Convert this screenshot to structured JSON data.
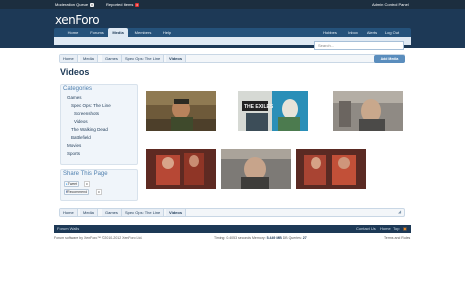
{
  "moderator_bar": {
    "moderation_queue_label": "Moderation Queue",
    "moderation_queue_count": "0",
    "reported_items_label": "Reported Items",
    "reported_items_count": "0",
    "control_panel_label": "Admin Control Panel"
  },
  "logo_text": "xenForo",
  "nav_tabs": [
    "Home",
    "Forums",
    "Media",
    "Members",
    "Help"
  ],
  "active_tab": "Media",
  "account_links": {
    "user": "Hobbes",
    "inbox": "Inbox",
    "alerts": "Alerts",
    "logout": "Log Out"
  },
  "search": {
    "placeholder": "Search..."
  },
  "breadcrumbs": [
    "Home",
    "Media",
    "Games",
    "Spec Ops: The Line",
    "Videos"
  ],
  "add_media_label": "Add Media",
  "page_title": "Videos",
  "categories": {
    "heading": "Categories",
    "items": [
      "Games",
      "Spec Ops: The Line",
      "Screenshots",
      "Videos",
      "The Walking Dead",
      "Battlefield",
      "Movies",
      "Sports"
    ]
  },
  "share": {
    "heading": "Share This Page",
    "tweet_label": "Tweet",
    "tweet_count": "0",
    "recommend_label": "Recommend",
    "recommend_count": "0"
  },
  "thumbnails": [
    {
      "caption": "",
      "scene": "soldier-desert"
    },
    {
      "caption": "THE EXILES",
      "scene": "exiles"
    },
    {
      "caption": "",
      "scene": "soldier-gray"
    },
    {
      "caption": "",
      "scene": "red-armor"
    },
    {
      "caption": "",
      "scene": "soldier-face"
    },
    {
      "caption": "",
      "scene": "red-armor-2"
    }
  ],
  "footer": {
    "left_link": "Forum Walls",
    "contact": "Contact Us",
    "home": "Home",
    "top": "Top"
  },
  "legal": {
    "copyright": "Forum software by XenForo™ ©2010-2012 XenForo Ltd.",
    "timing_prefix": "Timing: 0.4053 seconds Memory: ",
    "memory": "5.449 MB",
    "queries_prefix": " DB Queries: ",
    "queries": "27",
    "terms": "Terms and Rules"
  },
  "colors": {
    "header": "#1d3956",
    "nav": "#25527b",
    "accent": "#5a8dbd",
    "alert": "#e03030"
  }
}
